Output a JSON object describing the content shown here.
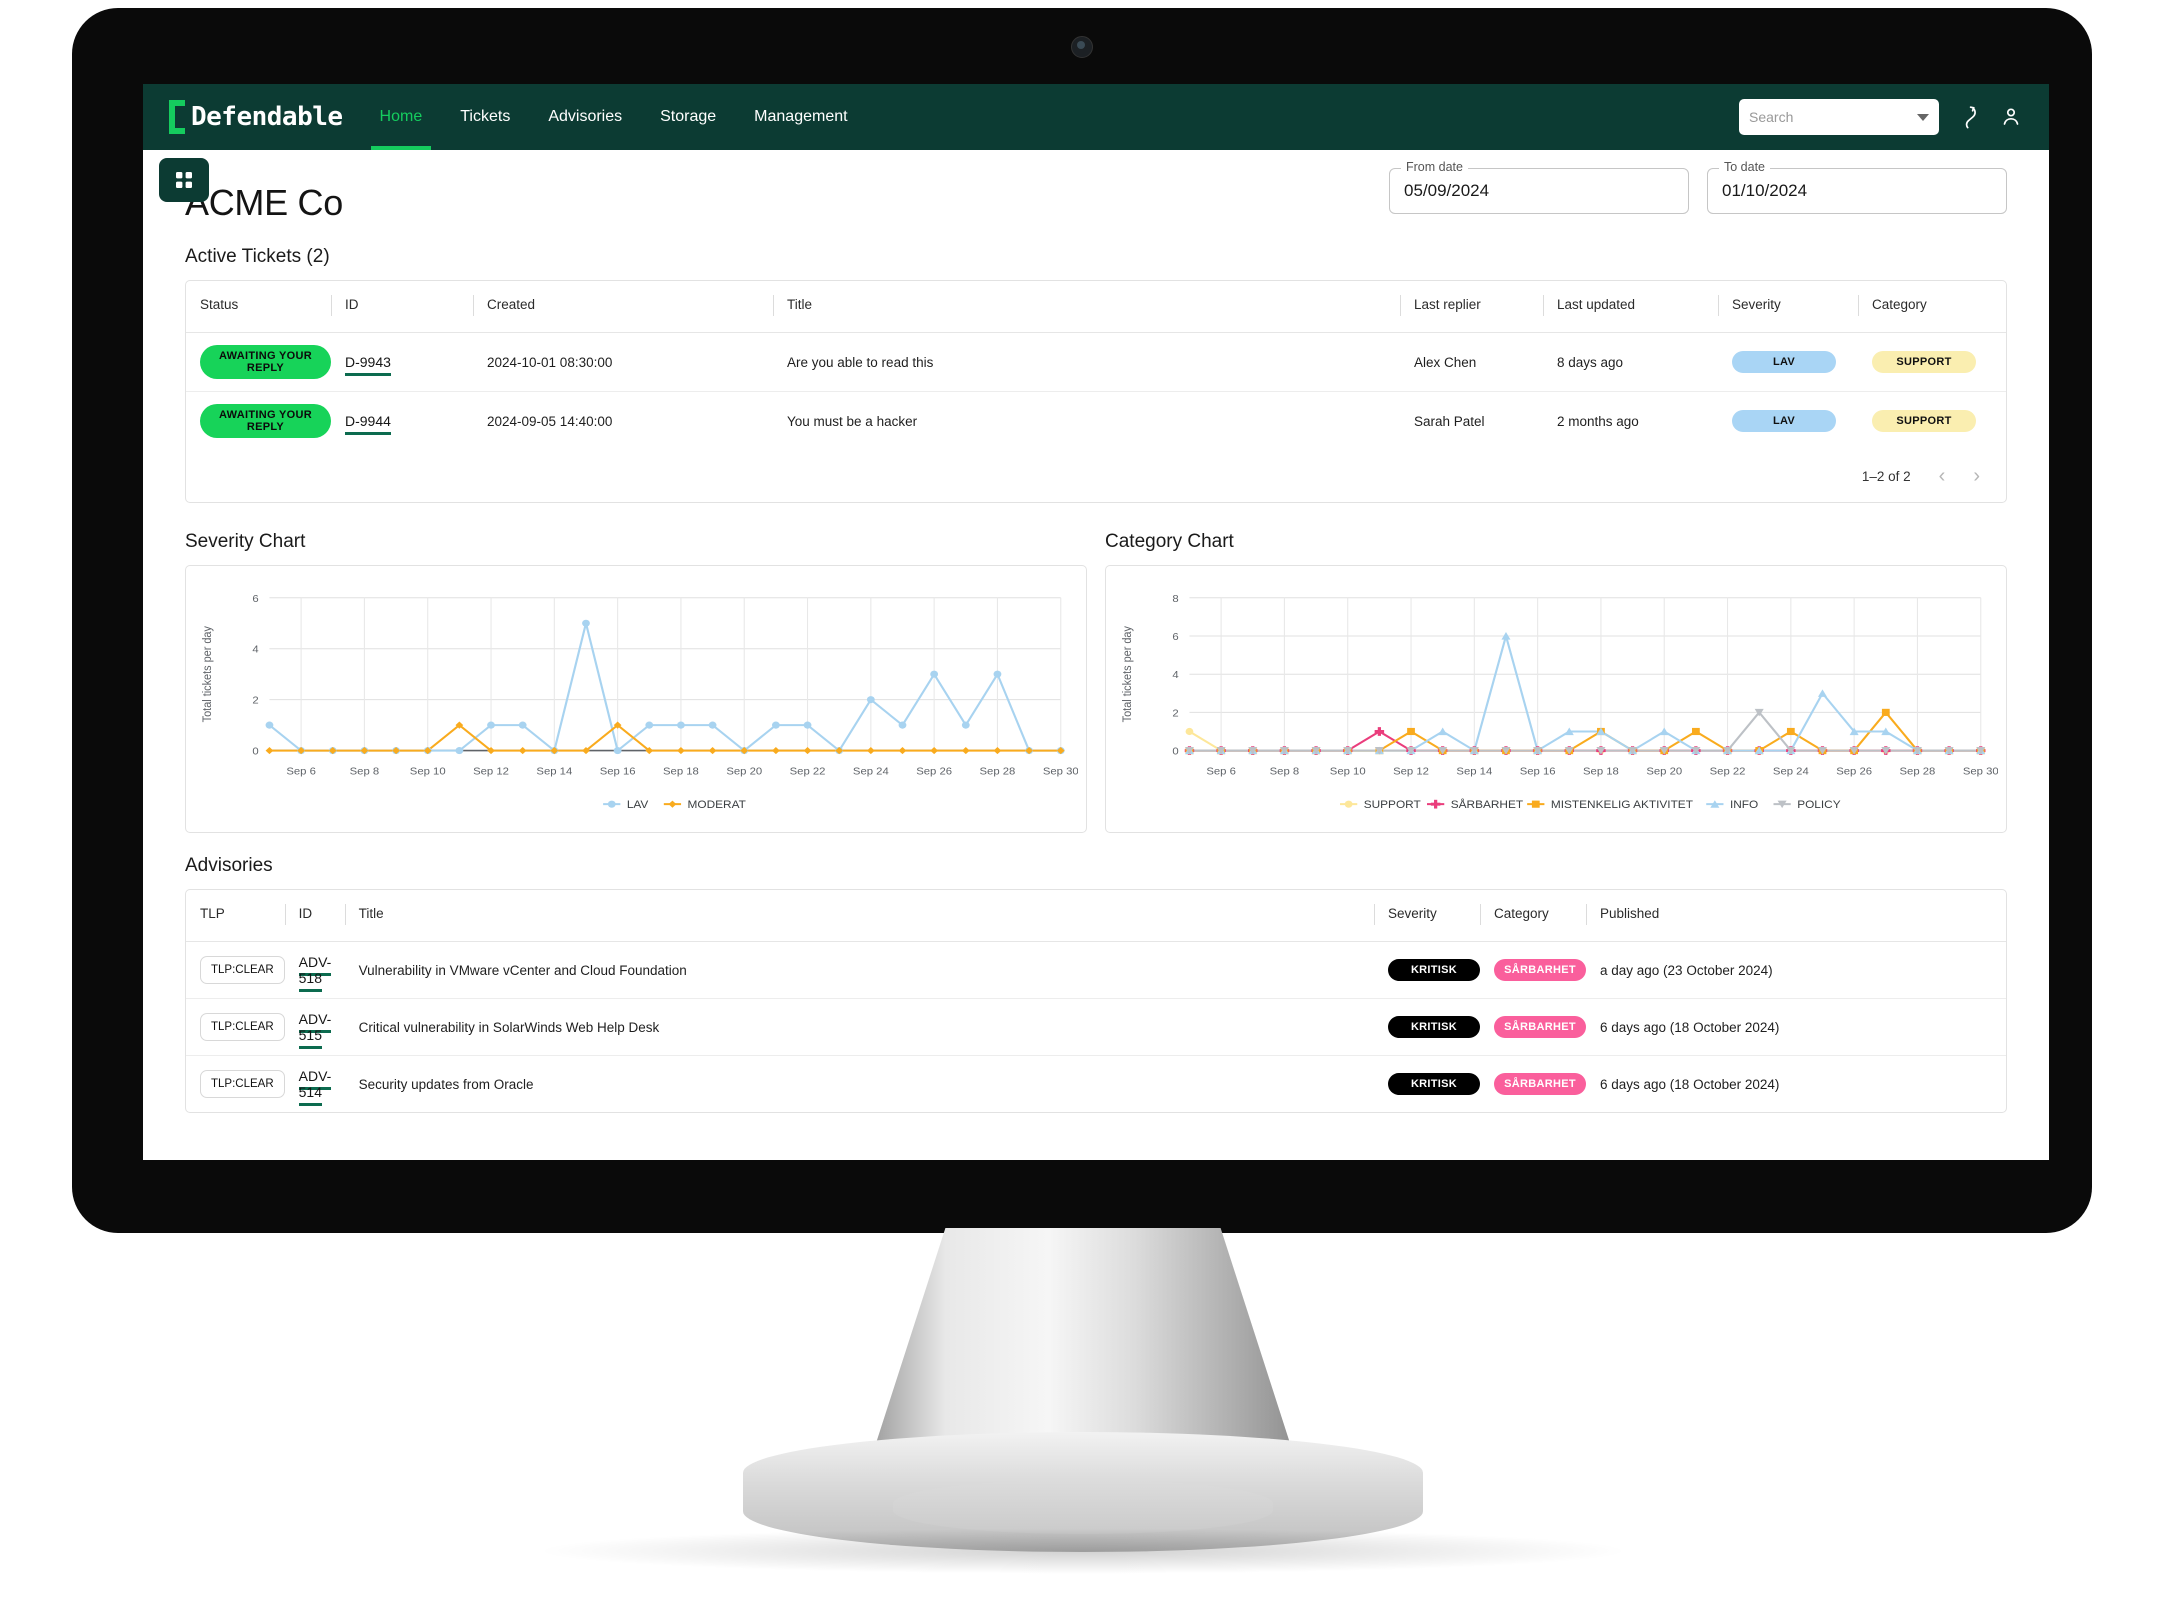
{
  "nav": {
    "brand": "Defendable",
    "links": [
      {
        "label": "Home",
        "active": true
      },
      {
        "label": "Tickets",
        "active": false
      },
      {
        "label": "Advisories",
        "active": false
      },
      {
        "label": "Storage",
        "active": false
      },
      {
        "label": "Management",
        "active": false
      }
    ],
    "search": {
      "value": "",
      "placeholder": "Search"
    },
    "icons": [
      "phone-icon",
      "user-account-icon",
      "chevron-down-icon",
      "apps-grid-icon"
    ]
  },
  "page": {
    "title": "ACME Co",
    "from_date_label": "From date",
    "from_date_value": "05/09/2024",
    "to_date_label": "To date",
    "to_date_value": "01/10/2024"
  },
  "tickets": {
    "heading": "Active Tickets (2)",
    "columns": [
      "Status",
      "ID",
      "Created",
      "Title",
      "Last replier",
      "Last updated",
      "Severity",
      "Category"
    ],
    "rows": [
      {
        "status": "AWAITING YOUR REPLY",
        "id": "D-9943",
        "created": "2024-10-01 08:30:00",
        "title": "Are you able to read this",
        "last_replier": "Alex Chen",
        "last_updated": "8 days ago",
        "severity": "LAV",
        "category": "SUPPORT"
      },
      {
        "status": "AWAITING YOUR REPLY",
        "id": "D-9944",
        "created": "2024-09-05 14:40:00",
        "title": "You must be a hacker",
        "last_replier": "Sarah Patel",
        "last_updated": "2 months ago",
        "severity": "LAV",
        "category": "SUPPORT"
      }
    ],
    "pagination": {
      "range": "1–2 of 2",
      "prev": "‹",
      "next": "›"
    }
  },
  "severity_chart_title": "Severity Chart",
  "category_chart_title": "Category Chart",
  "advisories": {
    "heading": "Advisories",
    "columns": [
      "TLP",
      "ID",
      "Title",
      "Severity",
      "Category",
      "Published"
    ],
    "rows": [
      {
        "tlp": "TLP:CLEAR",
        "id": "ADV-518",
        "title": "Vulnerability in VMware vCenter and Cloud Foundation",
        "severity": "KRITISK",
        "category": "SÅRBARHET",
        "published": "a day ago (23 October 2024)"
      },
      {
        "tlp": "TLP:CLEAR",
        "id": "ADV-515",
        "title": "Critical vulnerability in SolarWinds Web Help Desk",
        "severity": "KRITISK",
        "category": "SÅRBARHET",
        "published": "6 days ago (18 October 2024)"
      },
      {
        "tlp": "TLP:CLEAR",
        "id": "ADV-514",
        "title": "Security updates from Oracle",
        "severity": "KRITISK",
        "category": "SÅRBARHET",
        "published": "6 days ago (18 October 2024)"
      }
    ]
  },
  "colors": {
    "brand_dark": "#0c3b33",
    "brand_green": "#15cc5e",
    "lav_blue": "#a8d3f0",
    "moderat_orange": "#f9ab1e",
    "support_yellow": "#fde79a",
    "sarbarhet_pink": "#ea3d7c",
    "mistenkelig_orange": "#f9ab1e",
    "info_blue": "#a8d3f0",
    "policy_gray": "#bdc1c6"
  },
  "chart_data": [
    {
      "type": "line",
      "title": "Severity Chart",
      "xlabel": "",
      "ylabel": "Total tickets per day",
      "ylim": [
        0,
        6
      ],
      "yticks": [
        0,
        2,
        4,
        6
      ],
      "grid": true,
      "legend_position": "bottom",
      "x": [
        "Sep 5",
        "Sep 6",
        "Sep 7",
        "Sep 8",
        "Sep 9",
        "Sep 10",
        "Sep 11",
        "Sep 12",
        "Sep 13",
        "Sep 14",
        "Sep 15",
        "Sep 16",
        "Sep 17",
        "Sep 18",
        "Sep 19",
        "Sep 20",
        "Sep 21",
        "Sep 22",
        "Sep 23",
        "Sep 24",
        "Sep 25",
        "Sep 26",
        "Sep 27",
        "Sep 28",
        "Sep 29",
        "Sep 30"
      ],
      "tick_labels": [
        "Sep 6",
        "Sep 8",
        "Sep 10",
        "Sep 12",
        "Sep 14",
        "Sep 16",
        "Sep 18",
        "Sep 20",
        "Sep 22",
        "Sep 24",
        "Sep 26",
        "Sep 28",
        "Sep 30"
      ],
      "series": [
        {
          "name": "LAV",
          "color": "#a8d3f0",
          "marker": "circle",
          "values": [
            1,
            0,
            0,
            0,
            0,
            0,
            0,
            1,
            1,
            0,
            5,
            0,
            1,
            1,
            1,
            0,
            1,
            1,
            0,
            2,
            1,
            3,
            1,
            3,
            0,
            0
          ]
        },
        {
          "name": "MODERAT",
          "color": "#f9ab1e",
          "marker": "diamond",
          "values": [
            0,
            0,
            0,
            0,
            0,
            0,
            1,
            0,
            0,
            0,
            0,
            1,
            0,
            0,
            0,
            0,
            0,
            0,
            0,
            0,
            0,
            0,
            0,
            0,
            0,
            0
          ]
        }
      ]
    },
    {
      "type": "line",
      "title": "Category Chart",
      "xlabel": "",
      "ylabel": "Total tickets per day",
      "ylim": [
        0,
        8
      ],
      "yticks": [
        0,
        2,
        4,
        6,
        8
      ],
      "grid": true,
      "legend_position": "bottom",
      "x": [
        "Sep 5",
        "Sep 6",
        "Sep 7",
        "Sep 8",
        "Sep 9",
        "Sep 10",
        "Sep 11",
        "Sep 12",
        "Sep 13",
        "Sep 14",
        "Sep 15",
        "Sep 16",
        "Sep 17",
        "Sep 18",
        "Sep 19",
        "Sep 20",
        "Sep 21",
        "Sep 22",
        "Sep 23",
        "Sep 24",
        "Sep 25",
        "Sep 26",
        "Sep 27",
        "Sep 28",
        "Sep 29",
        "Sep 30"
      ],
      "tick_labels": [
        "Sep 6",
        "Sep 8",
        "Sep 10",
        "Sep 12",
        "Sep 14",
        "Sep 16",
        "Sep 18",
        "Sep 20",
        "Sep 22",
        "Sep 24",
        "Sep 26",
        "Sep 28",
        "Sep 30"
      ],
      "series": [
        {
          "name": "SUPPORT",
          "color": "#fde79a",
          "marker": "circle",
          "values": [
            1,
            0,
            0,
            0,
            0,
            0,
            0,
            0,
            0,
            0,
            0,
            0,
            0,
            0,
            0,
            0,
            0,
            0,
            0,
            0,
            0,
            0,
            0,
            0,
            0,
            0
          ]
        },
        {
          "name": "SÅRBARHET",
          "color": "#ea3d7c",
          "marker": "plus",
          "values": [
            0,
            0,
            0,
            0,
            0,
            0,
            1,
            0,
            0,
            0,
            0,
            0,
            0,
            0,
            0,
            0,
            0,
            0,
            0,
            0,
            0,
            0,
            0,
            0,
            0,
            0
          ]
        },
        {
          "name": "MISTENKELIG AKTIVITET",
          "color": "#f9ab1e",
          "marker": "square",
          "values": [
            0,
            0,
            0,
            0,
            0,
            0,
            0,
            1,
            0,
            0,
            0,
            0,
            0,
            1,
            0,
            0,
            1,
            0,
            0,
            1,
            0,
            0,
            2,
            0,
            0,
            0
          ]
        },
        {
          "name": "INFO",
          "color": "#a8d3f0",
          "marker": "triangle",
          "values": [
            0,
            0,
            0,
            0,
            0,
            0,
            0,
            0,
            1,
            0,
            6,
            0,
            1,
            1,
            0,
            1,
            0,
            0,
            0,
            0,
            3,
            1,
            1,
            0,
            0,
            0
          ]
        },
        {
          "name": "POLICY",
          "color": "#bdc1c6",
          "marker": "tri-down",
          "values": [
            0,
            0,
            0,
            0,
            0,
            0,
            0,
            0,
            0,
            0,
            0,
            0,
            0,
            0,
            0,
            0,
            0,
            0,
            2,
            0,
            0,
            0,
            0,
            0,
            0,
            0
          ]
        }
      ]
    }
  ]
}
